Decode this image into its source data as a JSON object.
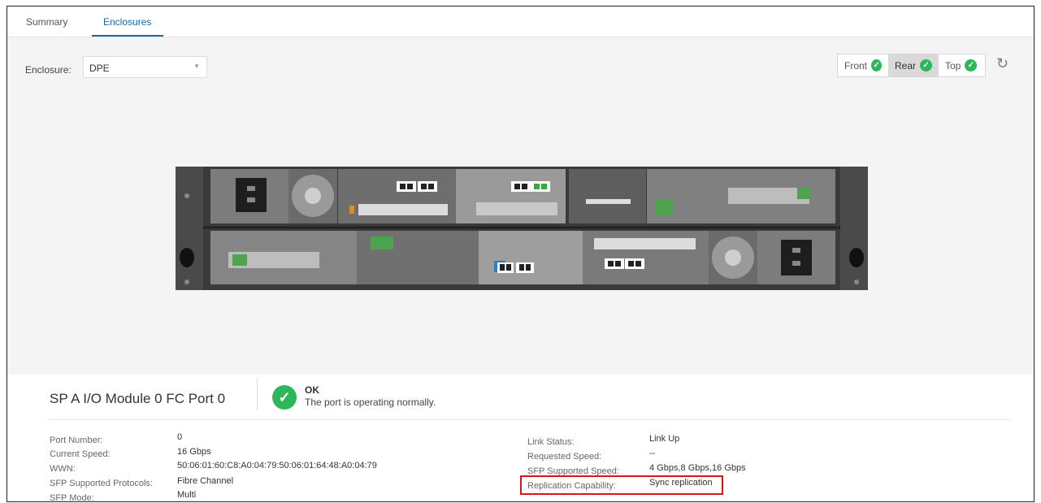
{
  "tabs": [
    {
      "label": "Summary",
      "active": false
    },
    {
      "label": "Enclosures",
      "active": true
    }
  ],
  "enclosure": {
    "label": "Enclosure:",
    "value": "DPE"
  },
  "views": [
    {
      "label": "Front",
      "status": "check-icon",
      "active": false
    },
    {
      "label": "Rear",
      "status": "check-icon",
      "active": true
    },
    {
      "label": "Top",
      "status": "check-icon",
      "active": false
    }
  ],
  "colors": {
    "accent": "#1a6aa8",
    "ok": "#2eb65a",
    "highlight": "#d9141a"
  },
  "port": {
    "title": "SP A I/O Module 0 FC Port 0",
    "status_title": "OK",
    "status_desc": "The port is operating normally."
  },
  "props_left": [
    {
      "key": "Port Number:",
      "value": "0"
    },
    {
      "key": "Current Speed:",
      "value": "16 Gbps"
    },
    {
      "key": "WWN:",
      "value": "50:06:01:60:C8:A0:04:79:50:06:01:64:48:A0:04:79"
    },
    {
      "key": "SFP Supported Protocols:",
      "value": "Fibre Channel"
    },
    {
      "key": "SFP Mode:",
      "value": "Multi"
    }
  ],
  "props_right": [
    {
      "key": "Link Status:",
      "value": "Link Up"
    },
    {
      "key": "Requested Speed:",
      "value": "--"
    },
    {
      "key": "SFP Supported Speed:",
      "value": "4 Gbps,8 Gbps,16 Gbps"
    },
    {
      "key": "Replication Capability:",
      "value": "Sync replication"
    }
  ]
}
